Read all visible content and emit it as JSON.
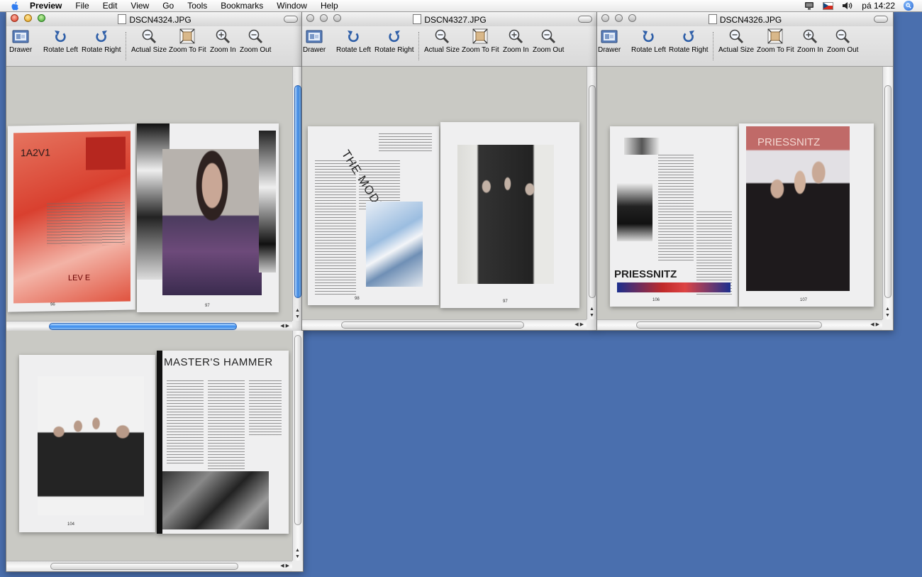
{
  "menubar": {
    "app_name": "Preview",
    "items": [
      "File",
      "Edit",
      "View",
      "Go",
      "Tools",
      "Bookmarks",
      "Window",
      "Help"
    ],
    "clock": "pá 14:22"
  },
  "toolbar": {
    "drawer": "Drawer",
    "rotate_left": "Rotate Left",
    "rotate_right": "Rotate Right",
    "actual_size": "Actual Size",
    "zoom_to_fit": "Zoom To Fit",
    "zoom_in": "Zoom In",
    "zoom_out": "Zoom Out"
  },
  "windows": [
    {
      "title": "DSCN4324.JPG",
      "active": true
    },
    {
      "title": "DSCN4327.JPG",
      "active": false
    },
    {
      "title": "DSCN4326.JPG",
      "active": false
    }
  ],
  "magazine": {
    "a2v1_heading": "1A2V1",
    "a2v1_footer": "LEV E",
    "models_heading": "THE MODELS",
    "priessnitz_heading": "PRIESSNITZ",
    "priessnitz_subheading": "PRIESSNITZ",
    "masters_heading": "MASTER'S HAMMER",
    "page_numbers": {
      "p1l": "96",
      "p1r": "97",
      "p2l": "98",
      "p2r": "97",
      "p3l": "106",
      "p3r": "107",
      "p4l": "104"
    }
  },
  "colors": {
    "desktop": "#4a6fae",
    "accent_scroll": "#3d8ef0"
  }
}
